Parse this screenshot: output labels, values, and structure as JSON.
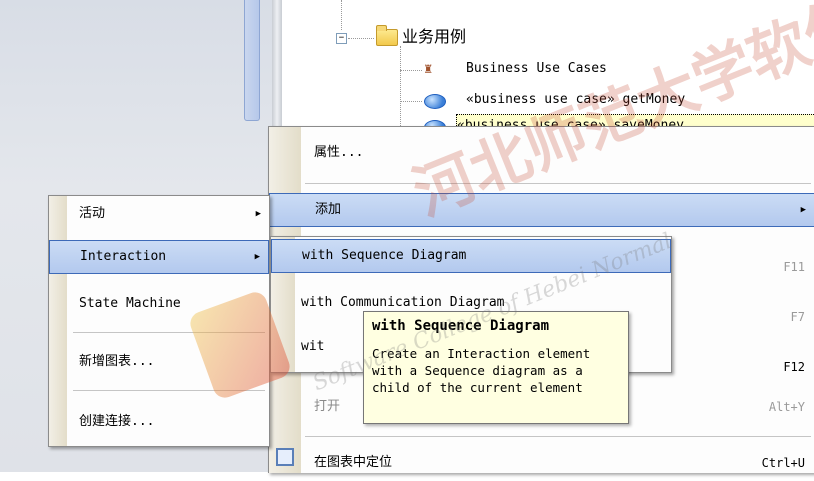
{
  "tree": {
    "folder_label": "业务用例",
    "items": [
      "Business Use Cases",
      "«business use case» getMoney",
      "«business use case» saveMoney"
    ]
  },
  "context_menu": {
    "items": [
      {
        "label": "属性..."
      },
      {
        "label": "添加"
      },
      {
        "label": "",
        "shortcut": "F11"
      },
      {
        "label": "",
        "shortcut": "F7"
      },
      {
        "label": "",
        "shortcut": "F12"
      },
      {
        "label": "打开",
        "shortcut": "Alt+Y"
      },
      {
        "label": "在图表中定位",
        "shortcut": "Ctrl+U"
      }
    ]
  },
  "add_submenu": {
    "items": [
      {
        "label": "活动"
      },
      {
        "label": "Interaction"
      },
      {
        "label": "State Machine"
      },
      {
        "label": "新增图表..."
      },
      {
        "label": "创建连接..."
      }
    ]
  },
  "interaction_submenu": {
    "items": [
      {
        "label": "with Sequence Diagram"
      },
      {
        "label": "with Communication Diagram"
      },
      {
        "label": "wit"
      }
    ]
  },
  "tooltip": {
    "title": "with Sequence Diagram",
    "lines": [
      "Create an Interaction element",
      "with a Sequence diagram as a",
      "child of the current element"
    ]
  },
  "watermark": {
    "cn": "河北师范大学软件",
    "en": "Software College of Hebei Normal"
  }
}
